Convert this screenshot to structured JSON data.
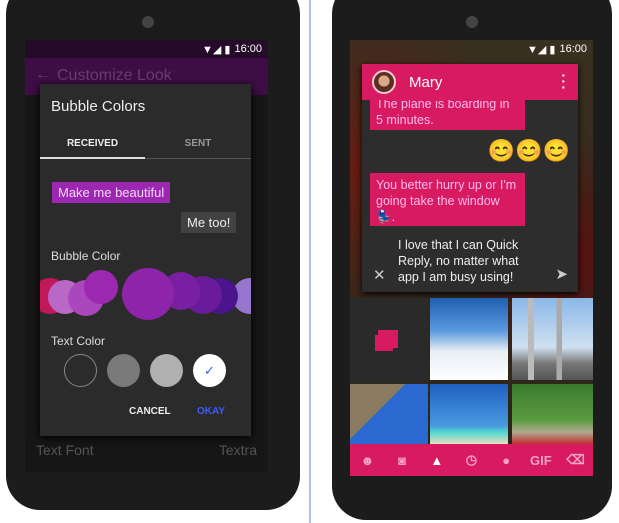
{
  "left": {
    "status": {
      "time": "16:00"
    },
    "toolbar": {
      "title": "Customize Look"
    },
    "background": {
      "text_font_label": "Text Font",
      "text_font_value": "Textra"
    },
    "dialog": {
      "title": "Bubble Colors",
      "tabs": [
        {
          "label": "RECEIVED",
          "active": true
        },
        {
          "label": "SENT",
          "active": false
        }
      ],
      "preview_received": "Make me beautiful",
      "preview_sent": "Me too!",
      "bubble_color_label": "Bubble Color",
      "bubble_colors": [
        "#c2185b",
        "#ba68c8",
        "#ab47bc",
        "#9c27b0",
        "#8e24aa",
        "#7b1fa2",
        "#6a1b9a",
        "#4a148c",
        "#9575cd"
      ],
      "selected_bubble_color": "#8e24aa",
      "text_color_label": "Text Color",
      "text_colors": [
        "#2b2b2b",
        "#7a7a7a",
        "#b0b0b0",
        "#ffffff"
      ],
      "selected_text_color": "#ffffff",
      "cancel": "CANCEL",
      "okay": "OKAY"
    }
  },
  "right": {
    "status": {
      "time": "16:00"
    },
    "contact": {
      "name": "Mary"
    },
    "messages": [
      {
        "text": "The plane is boarding in 5 minutes.",
        "type": "received"
      },
      {
        "text": "😊😊😊",
        "type": "sent"
      },
      {
        "text": "You better hurry up or I'm going take the window 💺.",
        "type": "received"
      }
    ],
    "reply_text": "I love that I can Quick Reply, no matter what app I am busy using!",
    "toolbar_icons": [
      "emoji-icon",
      "camera-icon",
      "gallery-icon",
      "recent-icon",
      "contact-icon",
      "gif-icon",
      "backspace-icon"
    ],
    "gif_label": "GIF",
    "accent": "#d81b60"
  }
}
